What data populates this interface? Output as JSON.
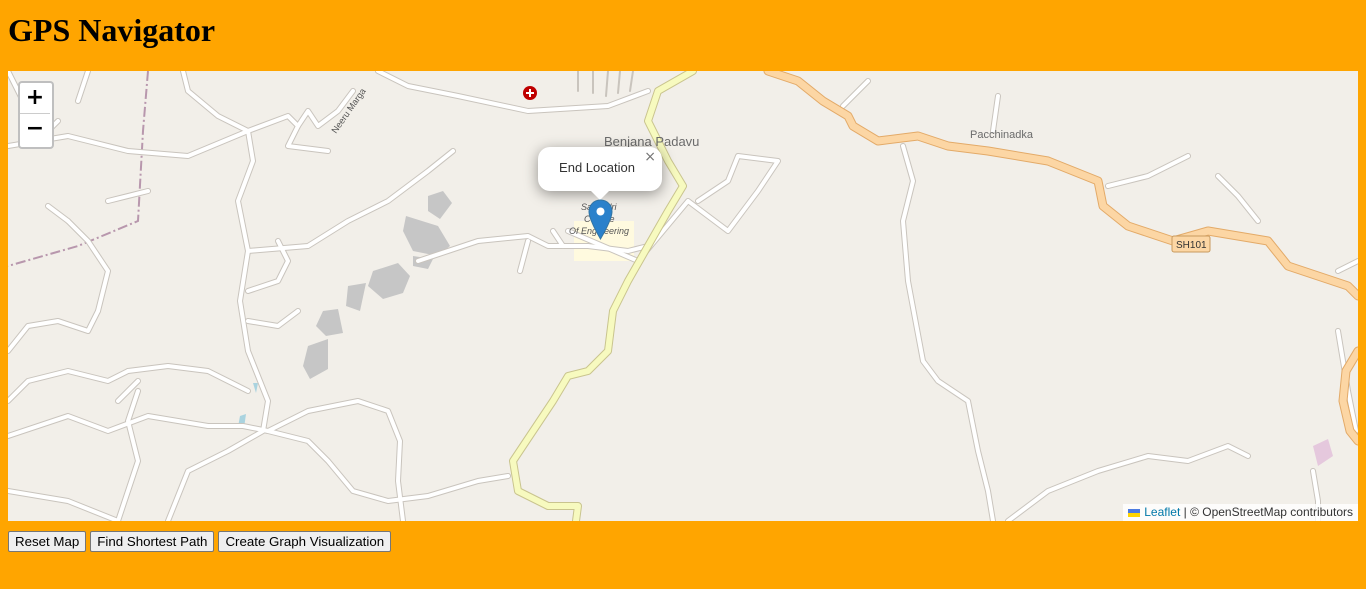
{
  "page": {
    "title": "GPS Navigator"
  },
  "map": {
    "zoom_in": "+",
    "zoom_out": "−",
    "place_labels": {
      "benjana": "Benjana Padavu",
      "pacchinadka": "Pacchinadka",
      "neeru": "Neeru Marga",
      "college_1": "Sahyadri",
      "college_2": "College",
      "college_3": "Of Engineering",
      "road_shield": "SH101"
    },
    "popup": {
      "text": "End Location",
      "close": "×"
    },
    "attribution": {
      "link": "Leaflet",
      "rest": " | © OpenStreetMap contributors"
    },
    "colors": {
      "background": "#f2efe9",
      "major_road": "#f9d29c",
      "secondary_road": "#f7fabf",
      "marker": "#2a81cb"
    }
  },
  "controls": {
    "reset": "Reset Map",
    "shortest": "Find Shortest Path",
    "graph": "Create Graph Visualization"
  }
}
